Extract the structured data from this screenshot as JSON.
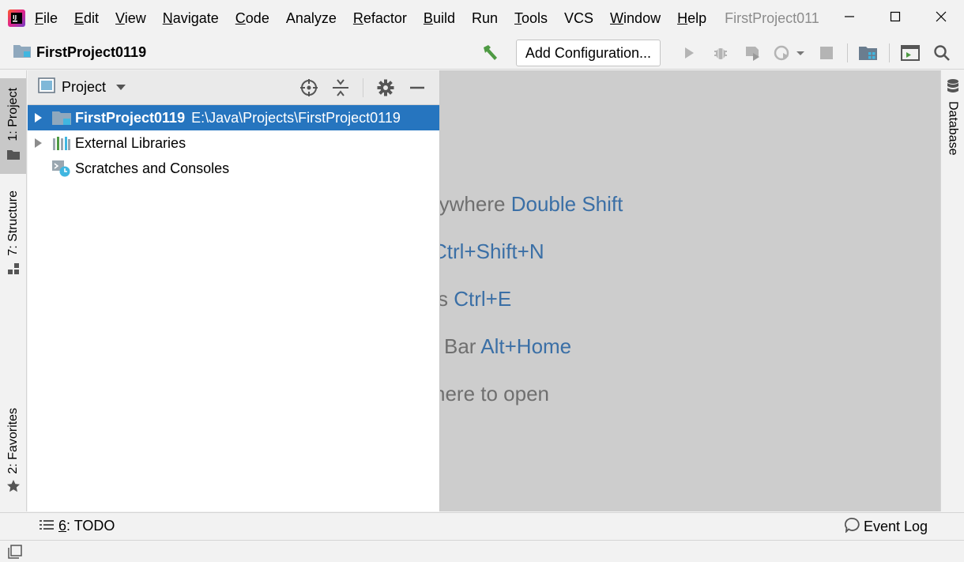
{
  "menubar": {
    "items": [
      {
        "mnemonic": "F",
        "rest": "ile"
      },
      {
        "mnemonic": "E",
        "rest": "dit"
      },
      {
        "mnemonic": "V",
        "rest": "iew"
      },
      {
        "mnemonic": "N",
        "rest": "avigate"
      },
      {
        "mnemonic": "C",
        "rest": "ode"
      },
      {
        "mnemonic": "",
        "rest": "Analyze"
      },
      {
        "mnemonic": "R",
        "rest": "efactor"
      },
      {
        "mnemonic": "B",
        "rest": "uild"
      },
      {
        "mnemonic": "",
        "rest": "Run"
      },
      {
        "mnemonic": "T",
        "rest": "ools"
      },
      {
        "mnemonic": "",
        "rest": "VCS"
      },
      {
        "mnemonic": "W",
        "rest": "indow"
      },
      {
        "mnemonic": "H",
        "rest": "elp"
      }
    ],
    "window_title": "FirstProject011"
  },
  "navbar": {
    "project_name": "FirstProject0119",
    "add_configuration_label": "Add Configuration..."
  },
  "left_stripe": {
    "project_tab": "1: Project",
    "structure_tab": "7: Structure",
    "favorites_tab": "2: Favorites"
  },
  "right_stripe": {
    "database_tab": "Database"
  },
  "project_panel": {
    "title": "Project",
    "tree": [
      {
        "label": "FirstProject0119",
        "path": "E:\\Java\\Projects\\FirstProject0119",
        "selected": true,
        "expandable": true
      },
      {
        "label": "External Libraries",
        "path": "",
        "selected": false,
        "expandable": true
      },
      {
        "label": "Scratches and Consoles",
        "path": "",
        "selected": false,
        "expandable": false
      }
    ]
  },
  "editor": {
    "hints": [
      {
        "text": "rywhere",
        "key": "Double Shift"
      },
      {
        "text": "",
        "key": "Ctrl+Shift+N"
      },
      {
        "text": "s",
        "key": "Ctrl+E"
      },
      {
        "text": "Bar",
        "key": "Alt+Home"
      },
      {
        "text": "here to open",
        "key": ""
      }
    ]
  },
  "bottombar": {
    "todo_mnemonic": "6",
    "todo_rest": ": TODO",
    "event_log": "Event Log"
  },
  "colors": {
    "selection": "#2675bf",
    "editor_bg": "#cdcdcd",
    "hint_key": "#3a6fa6",
    "hint_text": "#6f6f6f",
    "build_hammer": "#4e9a43"
  }
}
